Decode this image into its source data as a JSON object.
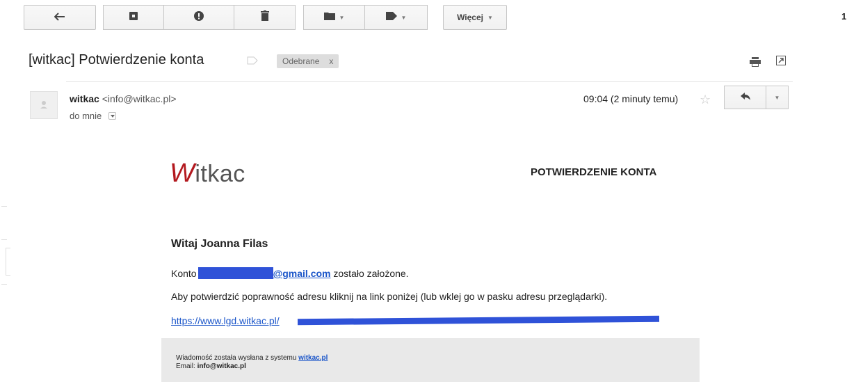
{
  "toolbar": {
    "more_label": "Więcej",
    "page_counter": "1"
  },
  "message": {
    "subject": "[witkac] Potwierdzenie konta",
    "label": "Odebrane",
    "label_remove": "x",
    "sender_name": "witkac",
    "sender_email": "<info@witkac.pl>",
    "to": "do mnie",
    "time": "09:04 (2 minuty temu)"
  },
  "email_body": {
    "logo_initial": "W",
    "logo_rest": "itkac",
    "title": "POTWIERDZENIE KONTA",
    "greeting": "Witaj Joanna Filas",
    "account_prefix": "Konto",
    "account_email_domain": "@gmail.com",
    "account_suffix": " zostało założone.",
    "instruction": "Aby potwierdzić poprawność adresu kliknij na link poniżej (lub wklej go w pasku adresu przeglądarki).",
    "link_visible": "https://www.lgd.witkac.pl/",
    "footer_prefix": "Wiadomość została wysłana z systemu ",
    "footer_link": "witkac.pl",
    "footer_email_label": "Email: ",
    "footer_email": "info@witkac.pl"
  },
  "colors": {
    "accent_red": "#b3191f",
    "link_blue": "#1a55c9",
    "redaction_blue": "#2f52d8"
  },
  "icons": [
    "back-arrow-icon",
    "archive-icon",
    "report-spam-icon",
    "delete-icon",
    "folder-icon",
    "label-icon",
    "print-icon",
    "new-window-icon",
    "avatar-icon",
    "star-icon",
    "reply-icon",
    "more-dropdown-icon"
  ]
}
